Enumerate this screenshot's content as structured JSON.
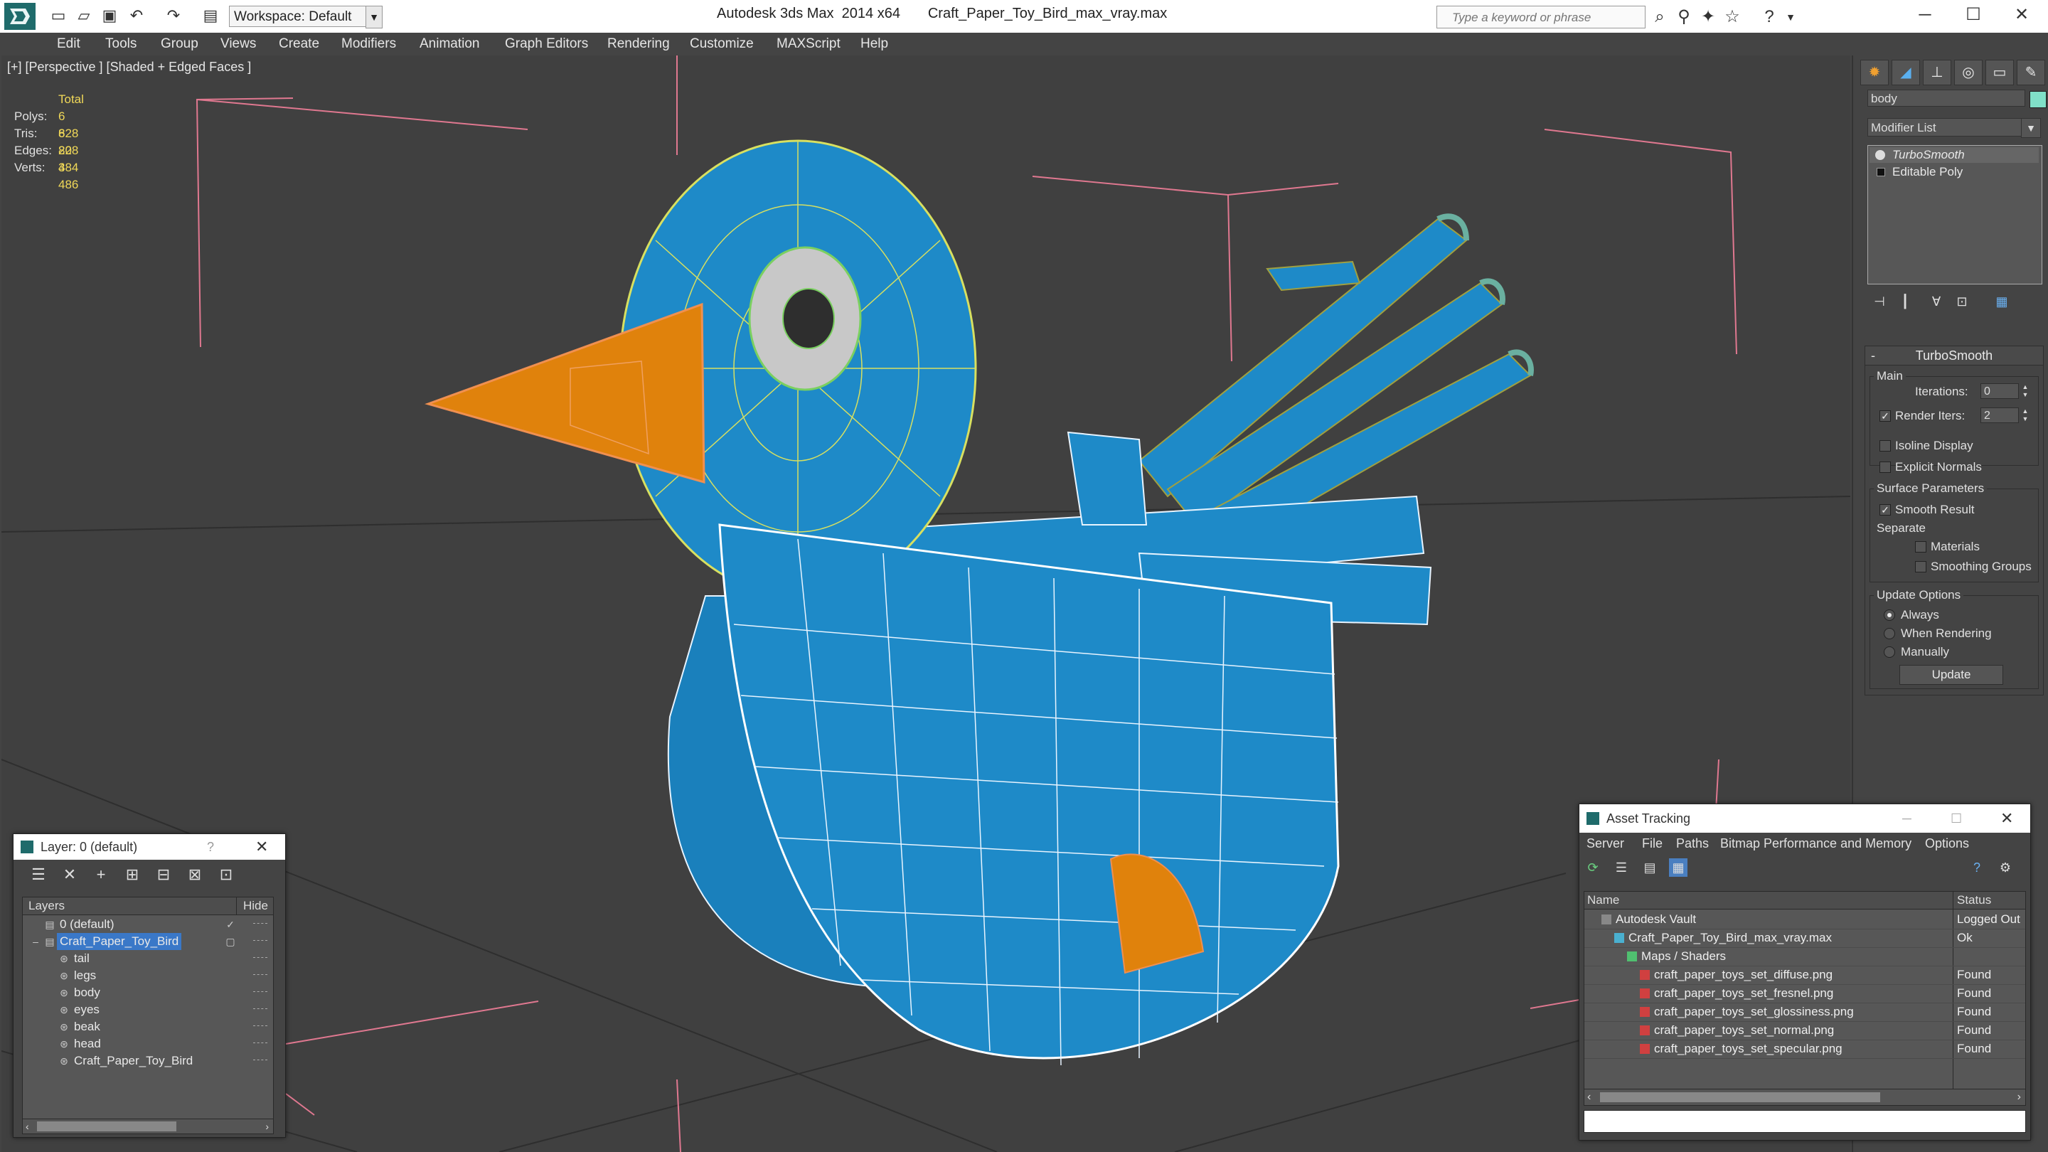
{
  "app": {
    "title": "Autodesk 3ds Max  2014 x64       Craft_Paper_Toy_Bird_max_vray.max",
    "workspace": "Workspace: Default",
    "search_placeholder": "Type a keyword or phrase"
  },
  "menu": [
    "Edit",
    "Tools",
    "Group",
    "Views",
    "Create",
    "Modifiers",
    "Animation",
    "Graph Editors",
    "Rendering",
    "Customize",
    "MAXScript",
    "Help"
  ],
  "viewport": {
    "label": "[+] [Perspective ] [Shaded + Edged Faces ]",
    "stats": {
      "header": "Total",
      "rows": [
        {
          "label": "Polys:",
          "value": "6 828"
        },
        {
          "label": "Tris:",
          "value": "6 828"
        },
        {
          "label": "Edges:",
          "value": "20 484"
        },
        {
          "label": "Verts:",
          "value": "3 486"
        }
      ]
    }
  },
  "command_panel": {
    "object_name": "body",
    "object_color": "#80e0c8",
    "modifier_list": "Modifier List",
    "stack": [
      "TurboSmooth",
      "Editable Poly"
    ],
    "turbosmooth": {
      "title": "TurboSmooth",
      "main_label": "Main",
      "iterations_label": "Iterations:",
      "iterations_value": "0",
      "render_iters_label": "Render Iters:",
      "render_iters_value": "2",
      "render_iters_checked": true,
      "isoline_label": "Isoline Display",
      "explicit_normals_label": "Explicit Normals",
      "surface_params_label": "Surface Parameters",
      "smooth_result_label": "Smooth Result",
      "smooth_result_checked": true,
      "separate_label": "Separate",
      "materials_label": "Materials",
      "smoothing_groups_label": "Smoothing Groups",
      "update_options_label": "Update Options",
      "always_label": "Always",
      "when_rendering_label": "When Rendering",
      "manually_label": "Manually",
      "update_button": "Update"
    }
  },
  "layer_window": {
    "title": "Layer: 0 (default)",
    "help": "?",
    "col_layers": "Layers",
    "col_hide": "Hide",
    "rows": [
      {
        "name": "0 (default)",
        "level": 0,
        "checked": true
      },
      {
        "name": "Craft_Paper_Toy_Bird",
        "level": 0,
        "selected": true
      },
      {
        "name": "tail",
        "level": 1
      },
      {
        "name": "legs",
        "level": 1
      },
      {
        "name": "body",
        "level": 1
      },
      {
        "name": "eyes",
        "level": 1
      },
      {
        "name": "beak",
        "level": 1
      },
      {
        "name": "head",
        "level": 1
      },
      {
        "name": "Craft_Paper_Toy_Bird",
        "level": 1
      }
    ]
  },
  "asset_window": {
    "title": "Asset Tracking",
    "menu": [
      "Server",
      "File",
      "Paths",
      "Bitmap Performance and Memory",
      "Options"
    ],
    "col_name": "Name",
    "col_status": "Status",
    "rows": [
      {
        "name": "Autodesk Vault",
        "status": "Logged Out",
        "level": 0,
        "icon": "vault"
      },
      {
        "name": "Craft_Paper_Toy_Bird_max_vray.max",
        "status": "Ok",
        "level": 1,
        "icon": "max"
      },
      {
        "name": "Maps / Shaders",
        "status": "",
        "level": 2,
        "icon": "folder"
      },
      {
        "name": "craft_paper_toys_set_diffuse.png",
        "status": "Found",
        "level": 3,
        "icon": "png"
      },
      {
        "name": "craft_paper_toys_set_fresnel.png",
        "status": "Found",
        "level": 3,
        "icon": "png"
      },
      {
        "name": "craft_paper_toys_set_glossiness.png",
        "status": "Found",
        "level": 3,
        "icon": "png"
      },
      {
        "name": "craft_paper_toys_set_normal.png",
        "status": "Found",
        "level": 3,
        "icon": "png"
      },
      {
        "name": "craft_paper_toys_set_specular.png",
        "status": "Found",
        "level": 3,
        "icon": "png"
      }
    ]
  }
}
